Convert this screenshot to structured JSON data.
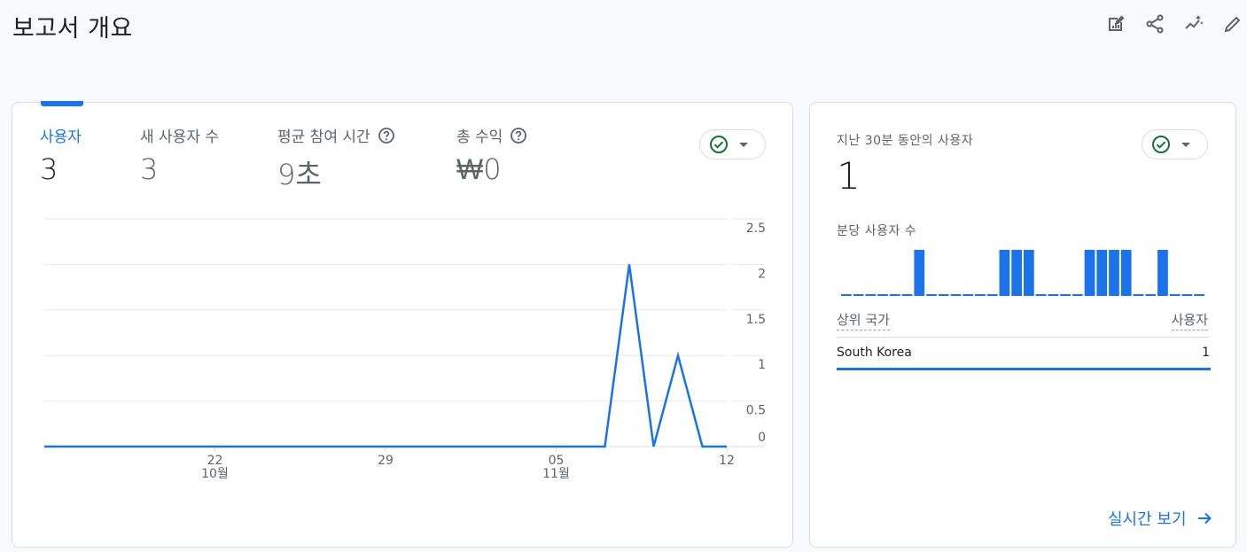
{
  "page": {
    "title": "보고서 개요"
  },
  "toolbar": {
    "icons": [
      "edit-report-icon",
      "share-icon",
      "insights-icon",
      "pencil-icon"
    ]
  },
  "metrics": [
    {
      "label": "사용자",
      "value": "3",
      "active": true
    },
    {
      "label": "새 사용자 수",
      "value": "3",
      "active": false
    },
    {
      "label": "평균 참여 시간",
      "value": "9초",
      "active": false,
      "help": true
    },
    {
      "label": "총 수익",
      "value": "₩0",
      "active": false,
      "help": true
    }
  ],
  "realtime": {
    "title": "지난 30분 동안의 사용자",
    "value": "1",
    "per_minute_label": "분당 사용자 수",
    "col_country": "상위 국가",
    "col_users": "사용자",
    "rows": [
      {
        "country": "South Korea",
        "users": "1"
      }
    ],
    "link_label": "실시간 보기",
    "minute_counts": [
      0,
      0,
      0,
      0,
      0,
      0,
      1,
      0,
      0,
      0,
      0,
      0,
      0,
      1,
      1,
      1,
      0,
      0,
      0,
      0,
      1,
      1,
      1,
      1,
      0,
      0,
      1,
      0,
      0,
      0
    ]
  },
  "chart_data": [
    {
      "type": "line",
      "x": [
        "10-15",
        "10-16",
        "10-17",
        "10-18",
        "10-19",
        "10-20",
        "10-21",
        "10-22",
        "10-23",
        "10-24",
        "10-25",
        "10-26",
        "10-27",
        "10-28",
        "10-29",
        "10-30",
        "10-31",
        "11-01",
        "11-02",
        "11-03",
        "11-04",
        "11-05",
        "11-06",
        "11-07",
        "11-08",
        "11-09",
        "11-10",
        "11-11",
        "11-12"
      ],
      "series": [
        {
          "values": [
            0,
            0,
            0,
            0,
            0,
            0,
            0,
            0,
            0,
            0,
            0,
            0,
            0,
            0,
            0,
            0,
            0,
            0,
            0,
            0,
            0,
            0,
            0,
            0,
            2,
            0,
            1,
            0,
            0
          ]
        }
      ],
      "x_ticks": [
        {
          "date": "10-22",
          "label": "22",
          "sublabel": "10월"
        },
        {
          "date": "10-29",
          "label": "29",
          "sublabel": ""
        },
        {
          "date": "11-05",
          "label": "05",
          "sublabel": "11월"
        },
        {
          "date": "11-12",
          "label": "12",
          "sublabel": ""
        }
      ],
      "y_ticks": [
        "2.5",
        "2",
        "1.5",
        "1",
        "0.5",
        "0"
      ],
      "ylim": [
        0,
        2.5
      ],
      "grid": true,
      "color": "#1a73e8"
    },
    {
      "type": "bar",
      "title": "분당 사용자 수",
      "values": [
        0,
        0,
        0,
        0,
        0,
        0,
        1,
        0,
        0,
        0,
        0,
        0,
        0,
        1,
        1,
        1,
        0,
        0,
        0,
        0,
        1,
        1,
        1,
        1,
        0,
        0,
        1,
        0,
        0,
        0
      ],
      "ylim": [
        0,
        1
      ],
      "color": "#1a73e8"
    }
  ],
  "colors": {
    "accent": "#1a73e8",
    "check": "#137333"
  }
}
